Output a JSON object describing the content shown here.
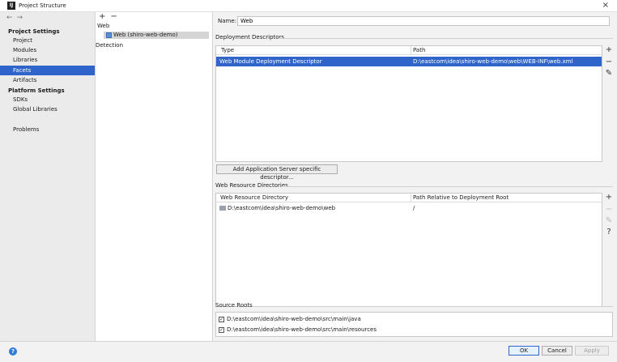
{
  "window": {
    "title": "Project Structure",
    "app_icon": "IJ",
    "close_icon": "×"
  },
  "nav": {
    "back": "←",
    "forward": "→",
    "project_settings_header": "Project Settings",
    "project_items": [
      "Project",
      "Modules",
      "Libraries",
      "Facets",
      "Artifacts"
    ],
    "platform_settings_header": "Platform Settings",
    "platform_items": [
      "SDKs",
      "Global Libraries"
    ],
    "problems": "Problems",
    "selected": "Facets"
  },
  "facets_tree": {
    "add": "+",
    "remove": "−",
    "group_web": "Web",
    "web_item": "Web (shiro-web-demo)",
    "detection": "Detection"
  },
  "facet": {
    "name_label": "Name:",
    "name_value": "Web",
    "deployment_descriptors": {
      "title": "Deployment Descriptors",
      "columns": [
        "Type",
        "Path"
      ],
      "rows": [
        {
          "type": "Web Module Deployment Descriptor",
          "path": "D:\\eastcom\\idea\\shiro-web-demo\\web\\WEB-INF\\web.xml"
        }
      ],
      "add_server_descriptor": "Add Application Server specific descriptor..."
    },
    "web_resource_directories": {
      "title": "Web Resource Directories",
      "columns": [
        "Web Resource Directory",
        "Path Relative to Deployment Root"
      ],
      "rows": [
        {
          "dir": "D:\\eastcom\\idea\\shiro-web-demo\\web",
          "relative": "/"
        }
      ]
    },
    "source_roots": {
      "title": "Source Roots",
      "items": [
        {
          "checked": true,
          "path": "D:\\eastcom\\idea\\shiro-web-demo\\src\\main\\java"
        },
        {
          "checked": true,
          "path": "D:\\eastcom\\idea\\shiro-web-demo\\src\\main\\resources"
        }
      ]
    },
    "table_tools": {
      "add": "+",
      "remove": "−",
      "edit": "✎",
      "help": "?"
    }
  },
  "footer": {
    "help": "?",
    "ok": "OK",
    "cancel": "Cancel",
    "apply": "Apply"
  },
  "colors": {
    "selection": "#2f65ca",
    "help_blue": "#2f7bd6"
  }
}
